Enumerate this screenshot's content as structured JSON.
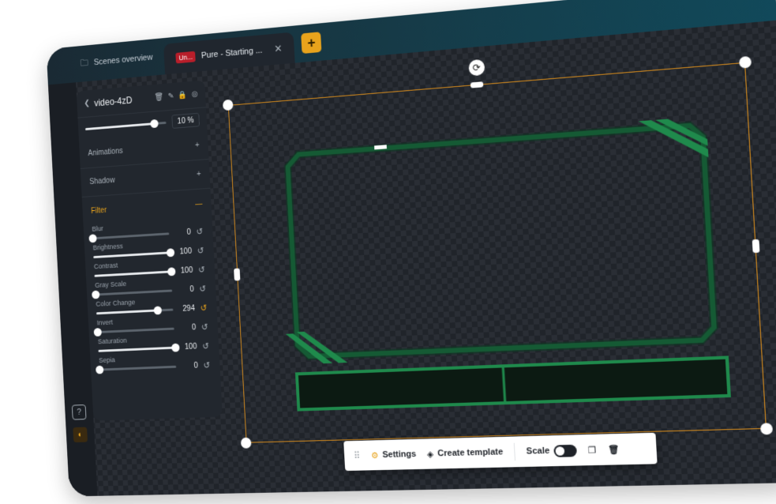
{
  "tabs": [
    {
      "label": "Scenes overview",
      "icon": "folder-icon"
    },
    {
      "badge": "Un...",
      "label": "Pure - Starting ...",
      "active": true
    }
  ],
  "add_tab_label": "+",
  "panel": {
    "title": "video-4zD",
    "opacity": {
      "value": "10 %",
      "level": 0.85
    },
    "sections": {
      "animations": "Animations",
      "shadow": "Shadow",
      "filter": "Filter"
    },
    "filters": [
      {
        "label": "Blur",
        "value": "0",
        "level": 0.0,
        "modified": false
      },
      {
        "label": "Brightness",
        "value": "100",
        "level": 1.0,
        "modified": false
      },
      {
        "label": "Contrast",
        "value": "100",
        "level": 1.0,
        "modified": false
      },
      {
        "label": "Gray Scale",
        "value": "0",
        "level": 0.0,
        "modified": false
      },
      {
        "label": "Color Change",
        "value": "294",
        "level": 0.8,
        "modified": true
      },
      {
        "label": "Invert",
        "value": "0",
        "level": 0.0,
        "modified": false
      },
      {
        "label": "Saturation",
        "value": "100",
        "level": 1.0,
        "modified": false
      },
      {
        "label": "Sepia",
        "value": "0",
        "level": 0.0,
        "modified": false
      }
    ]
  },
  "toolbar": {
    "settings": "Settings",
    "create_template": "Create template",
    "scale": "Scale",
    "scale_on": false
  },
  "colors": {
    "accent": "#e8a31c",
    "selection": "#d48a1c",
    "frame_green": "#1f8a4c"
  }
}
